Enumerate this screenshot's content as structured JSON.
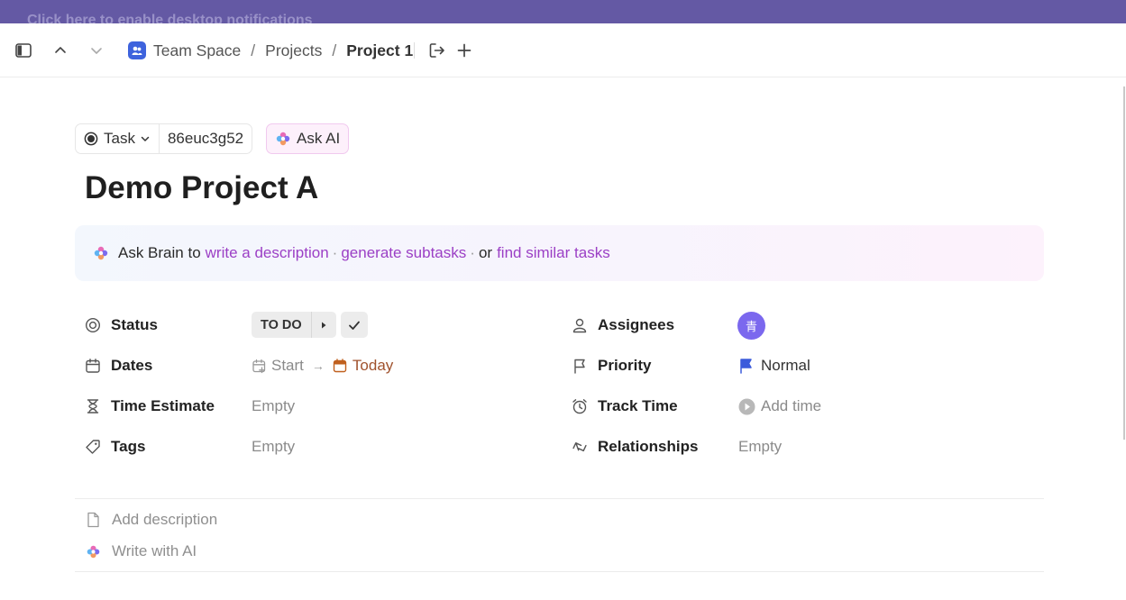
{
  "banner": {
    "text": "Click here to enable desktop notifications"
  },
  "toolbar": {
    "space": "Team Space",
    "folder": "Projects",
    "list": "Project 1",
    "separator": "/"
  },
  "task": {
    "type_label": "Task",
    "id": "86euc3g52",
    "ask_ai_label": "Ask AI",
    "title": "Demo Project A"
  },
  "brain": {
    "prefix": "Ask Brain to",
    "link1": "write a description",
    "link2": "generate subtasks",
    "dot": "·",
    "conj": "or",
    "link3": "find similar tasks"
  },
  "fields": {
    "status": {
      "label": "Status",
      "value": "TO DO"
    },
    "dates": {
      "label": "Dates",
      "start": "Start",
      "arrow": "→",
      "due": "Today",
      "due_color": "#a0522d"
    },
    "time_estimate": {
      "label": "Time Estimate",
      "value": "Empty"
    },
    "tags": {
      "label": "Tags",
      "value": "Empty"
    },
    "assignees": {
      "label": "Assignees",
      "avatar_text": "青",
      "avatar_color": "#7b68ee"
    },
    "priority": {
      "label": "Priority",
      "value": "Normal",
      "flag_color": "#3b5bdb"
    },
    "track_time": {
      "label": "Track Time",
      "value": "Add time"
    },
    "relationships": {
      "label": "Relationships",
      "value": "Empty"
    }
  },
  "description": {
    "add_label": "Add description",
    "ai_label": "Write with AI"
  },
  "colors": {
    "banner": "#6459a4",
    "link": "#9b3fc5",
    "space_icon": "#3e63dd"
  }
}
